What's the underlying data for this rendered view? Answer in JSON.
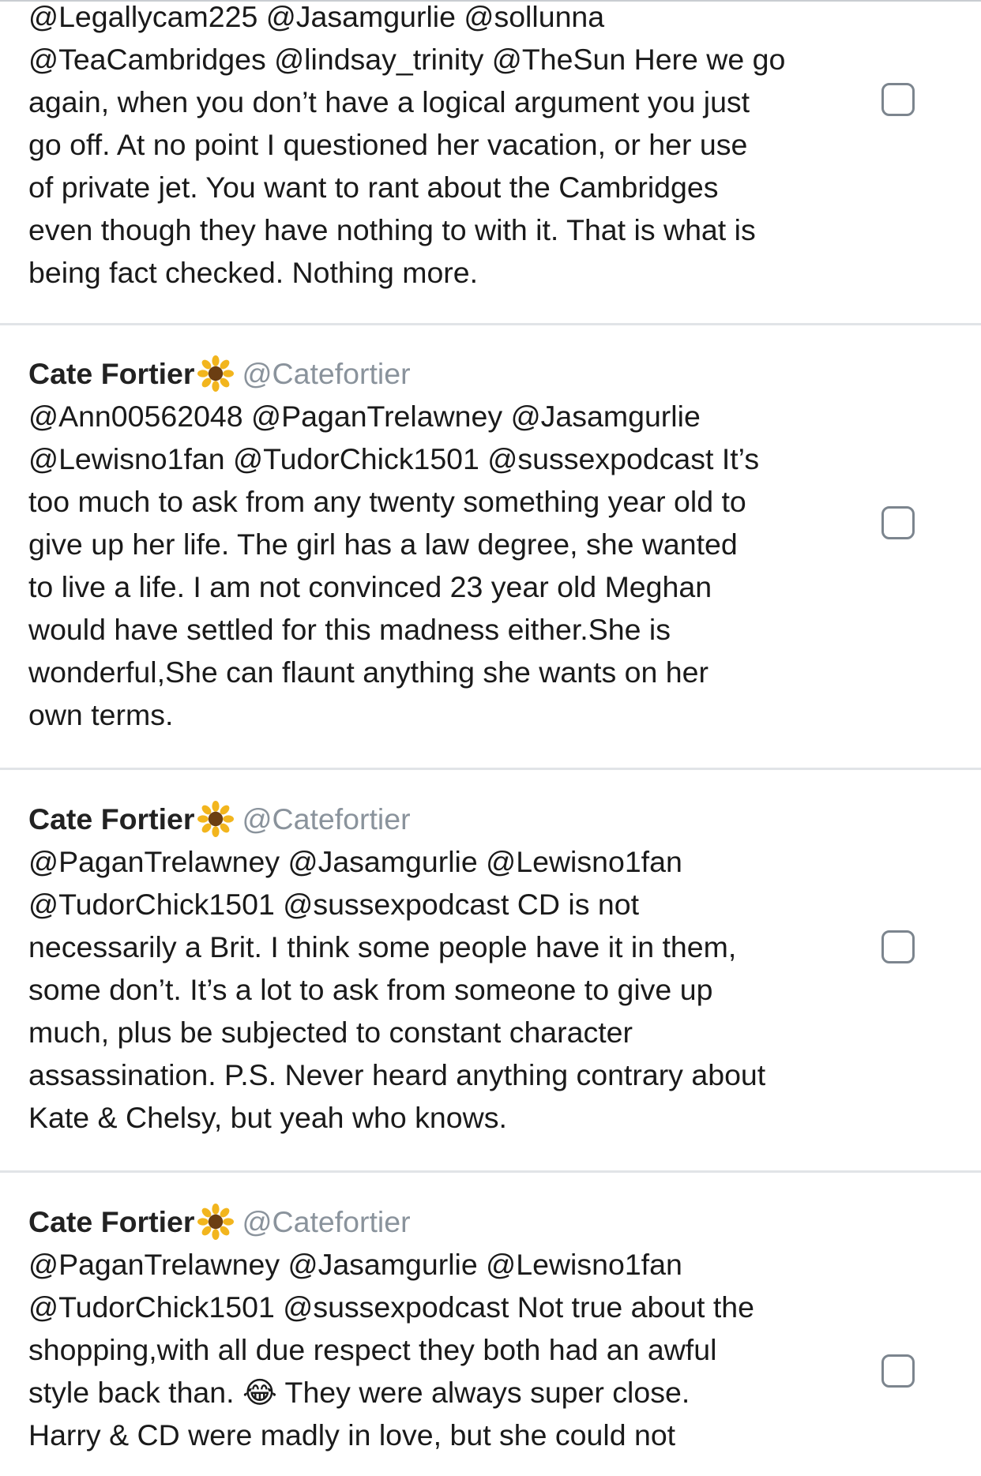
{
  "tweets": [
    {
      "has_header": false,
      "text": "@Legallycam225 @Jasamgurlie @sollunna\n@TeaCambridges @lindsay_trinity @TheSun Here we go\nagain, when you don’t have a logical argument you just\ngo off. At no point I questioned her vacation, or her use\nof private jet. You want to rant about the Cambridges\neven though they have nothing to with it. That is what is\nbeing fact checked. Nothing more."
    },
    {
      "has_header": true,
      "author": "Cate Fortier",
      "emoji": "sunflower-icon",
      "handle": "@Catefortier",
      "text": "@Ann00562048 @PaganTrelawney @Jasamgurlie\n@Lewisno1fan @TudorChick1501 @sussexpodcast It’s\ntoo much to ask from any twenty something year old to\ngive up her life. The girl has a law degree, she wanted\nto live a life. I am not convinced 23 year old Meghan\nwould have settled for this madness either.She is\nwonderful,She can flaunt anything she wants on her\nown terms."
    },
    {
      "has_header": true,
      "author": "Cate Fortier",
      "emoji": "sunflower-icon",
      "handle": "@Catefortier",
      "text": "@PaganTrelawney @Jasamgurlie @Lewisno1fan\n@TudorChick1501 @sussexpodcast CD is not\nnecessarily a Brit. I think some people have it in them,\nsome don’t. It’s a lot to ask from someone to give up\nmuch, plus be subjected to constant character\nassassination. P.S. Never heard anything contrary about\nKate & Chelsy,  but yeah who knows."
    },
    {
      "has_header": true,
      "author": "Cate Fortier",
      "emoji": "sunflower-icon",
      "handle": "@Catefortier",
      "text": "@PaganTrelawney @Jasamgurlie @Lewisno1fan\n@TudorChick1501 @sussexpodcast Not true about the\nshopping,with all due respect they both had an awful\nstyle back than. 😂 They were always super close.\nHarry & CD were madly in love, but she could not"
    }
  ],
  "colors": {
    "handle": "#8a939c",
    "divider": "#e1e4e7",
    "checkbox_border": "#7c858e"
  }
}
